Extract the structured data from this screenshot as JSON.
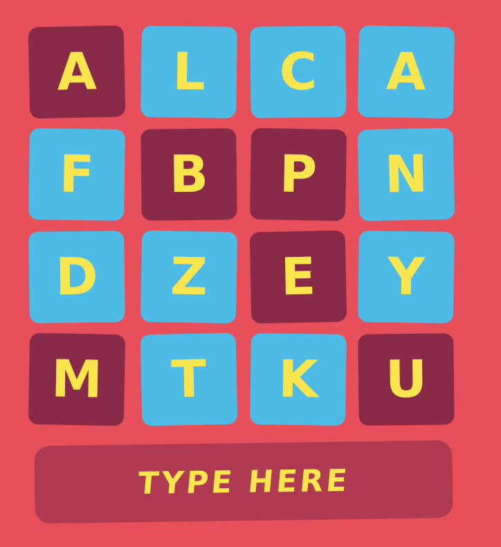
{
  "colors": {
    "background": "#e74f5b",
    "tile_blue": "#4dbbe6",
    "tile_selected": "#8a2a49",
    "letter": "#f9e64f",
    "type_bar": "#b03a52"
  },
  "board": {
    "tiles": [
      {
        "letter": "A",
        "selected": true
      },
      {
        "letter": "L",
        "selected": false
      },
      {
        "letter": "C",
        "selected": false
      },
      {
        "letter": "A",
        "selected": false
      },
      {
        "letter": "F",
        "selected": false
      },
      {
        "letter": "B",
        "selected": true
      },
      {
        "letter": "P",
        "selected": true
      },
      {
        "letter": "N",
        "selected": false
      },
      {
        "letter": "D",
        "selected": false
      },
      {
        "letter": "Z",
        "selected": false
      },
      {
        "letter": "E",
        "selected": true
      },
      {
        "letter": "Y",
        "selected": false
      },
      {
        "letter": "M",
        "selected": true
      },
      {
        "letter": "T",
        "selected": false
      },
      {
        "letter": "K",
        "selected": false
      },
      {
        "letter": "U",
        "selected": true
      }
    ]
  },
  "input": {
    "label": "TYPE HERE"
  }
}
